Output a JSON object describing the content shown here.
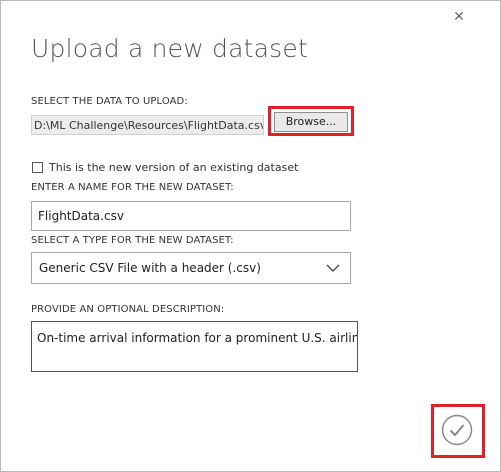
{
  "dialog": {
    "title": "Upload a new dataset",
    "close_icon": "close-icon",
    "close_glyph": "✕"
  },
  "upload": {
    "label": "SELECT THE DATA TO UPLOAD:",
    "file_path": "D:\\ML Challenge\\Resources\\FlightData.csv",
    "browse_label": "Browse..."
  },
  "existing_dataset": {
    "checked": false,
    "label": "This is the new version of an existing dataset"
  },
  "name": {
    "label": "ENTER A NAME FOR THE NEW DATASET:",
    "value": "FlightData.csv"
  },
  "type": {
    "label": "SELECT A TYPE FOR THE NEW DATASET:",
    "selected": "Generic CSV File with a header (.csv)",
    "chevron_icon": "chevron-down-icon"
  },
  "description": {
    "label": "PROVIDE AN OPTIONAL DESCRIPTION:",
    "value": "On-time arrival information for a prominent U.S. airline"
  },
  "confirm": {
    "icon": "checkmark-icon"
  },
  "colors": {
    "highlight": "#e0202c",
    "title_text": "#555555",
    "readonly_field_bg": "#ececec"
  }
}
